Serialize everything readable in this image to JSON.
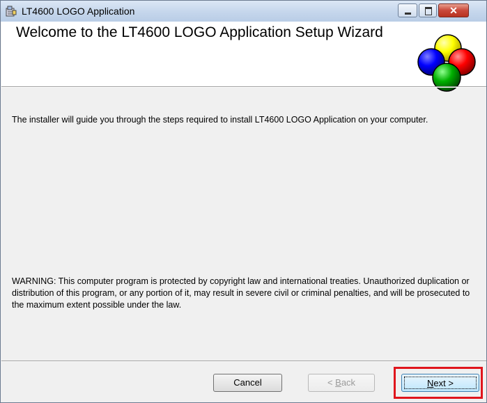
{
  "window": {
    "title": "LT4600 LOGO Application",
    "controls": {
      "minimize": "minimize",
      "maximize": "maximize",
      "close": "✕"
    }
  },
  "banner": {
    "title": "Welcome to the LT4600 LOGO Application Setup Wizard",
    "logo_colors": [
      "#ffff00",
      "#0000ff",
      "#ff0000",
      "#00aa00"
    ]
  },
  "body": {
    "intro": "The installer will guide you through the steps required to install LT4600 LOGO Application on your computer.",
    "warning": "WARNING: This computer program is protected by copyright law and international treaties. Unauthorized duplication or distribution of this program, or any portion of it, may result in severe civil or criminal penalties, and will be prosecuted to the maximum extent possible under the law."
  },
  "buttons": {
    "cancel": "Cancel",
    "back": {
      "mnemonic": "B",
      "rest": "ack",
      "prefix": "< "
    },
    "next": {
      "mnemonic": "N",
      "rest": "ext >"
    }
  },
  "highlight_color": "#e0151c"
}
